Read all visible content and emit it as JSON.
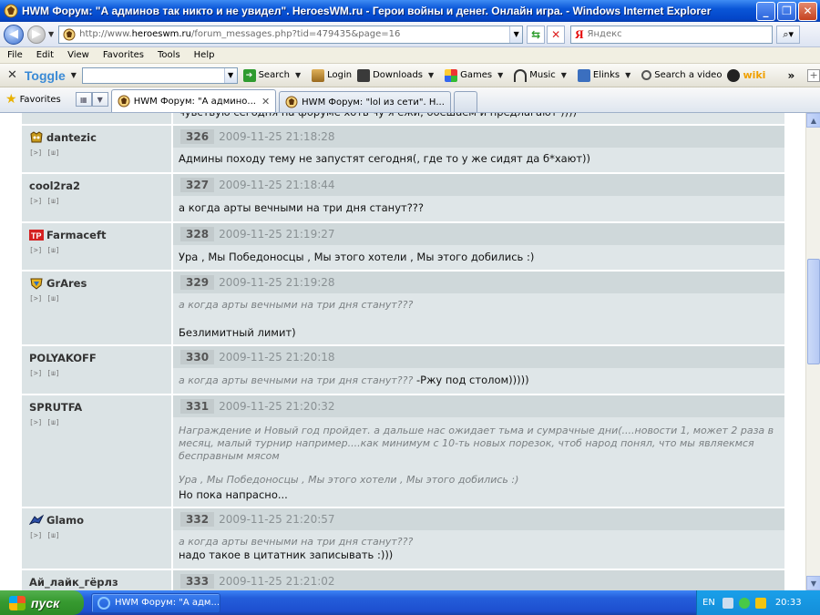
{
  "window": {
    "title": "HWM Форум: \"А админов так никто и не увидел\". HeroesWM.ru - Герои войны и денег. Онлайн игра. - Windows Internet Explorer",
    "minimize": "_",
    "maximize": "❐",
    "close": "✕"
  },
  "address": {
    "url_prefix": "http://www.",
    "url_domain": "heroeswm.ru",
    "url_path": "/forum_messages.php?tid=479435&page=16",
    "search_placeholder": "Яндекс",
    "search_logo": "Я"
  },
  "menu": [
    "File",
    "Edit",
    "View",
    "Favorites",
    "Tools",
    "Help"
  ],
  "toolbar": {
    "toggle": "Toggle",
    "items": [
      "Search",
      "Login",
      "Downloads",
      "Games",
      "Music",
      "Elinks",
      "Search a video"
    ],
    "wiki": "wiki",
    "more": "»"
  },
  "tabs": {
    "favorites": "Favorites",
    "items": [
      {
        "label": "HWM Форум: \"А админо...",
        "active": true
      },
      {
        "label": "HWM Форум: \"lol из сети\". Н...",
        "active": false
      }
    ]
  },
  "posts": [
    {
      "author": "dantezic",
      "num": "326",
      "date": "2009-11-25 21:18:28",
      "quote": "",
      "text": "Админы походу тему не запустят сегодня(, где то у же сидят да б*хают))"
    },
    {
      "author": "cool2ra2",
      "num": "327",
      "date": "2009-11-25 21:18:44",
      "quote": "",
      "text": "а когда арты вечными на три дня станут???"
    },
    {
      "author": "Farmaceft",
      "num": "328",
      "date": "2009-11-25 21:19:27",
      "quote": "",
      "text": "Ура , Мы Победоносцы , Мы этого хотели , Мы этого добились :)"
    },
    {
      "author": "GrAres",
      "num": "329",
      "date": "2009-11-25 21:19:28",
      "quote": "а когда арты вечными на три дня станут???",
      "text": "Безлимитный лимит)"
    },
    {
      "author": "POLYAKOFF",
      "num": "330",
      "date": "2009-11-25 21:20:18",
      "quote": "а когда арты вечными на три дня станут???",
      "text": "-Ржу под столом)))))"
    },
    {
      "author": "SPRUTFA",
      "num": "331",
      "date": "2009-11-25 21:20:32",
      "quote": "Награждение и Новый год пройдет. а дальше нас ожидает тьма и сумрачные дни(....новости 1, может 2 раза в месяц, малый турнир например....как минимум с 10-ть новых порезок, чтоб народ понял, что мы являекмся бесправным мясом",
      "quote2": "Ура , Мы Победоносцы , Мы этого хотели , Мы этого добились :)",
      "text": "Но пока напрасно..."
    },
    {
      "author": "Glamo",
      "num": "332",
      "date": "2009-11-25 21:20:57",
      "quote": "а когда арты вечными на три дня станут???",
      "text": "надо такое в цитатник записывать :)))"
    },
    {
      "author": "Ай_лайк_гёрлз",
      "num": "333",
      "date": "2009-11-25 21:21:02",
      "quote": "",
      "text": ""
    }
  ],
  "partial_top_text": "чувствую сегодня на форуме хоть чу я ежи, обешаем и предлагают ))))",
  "author_links": "[>] [ш]",
  "taskbar": {
    "start": "пуск",
    "task": "HWM Форум: \"А адм...",
    "lang": "EN",
    "clock": "20:33"
  }
}
